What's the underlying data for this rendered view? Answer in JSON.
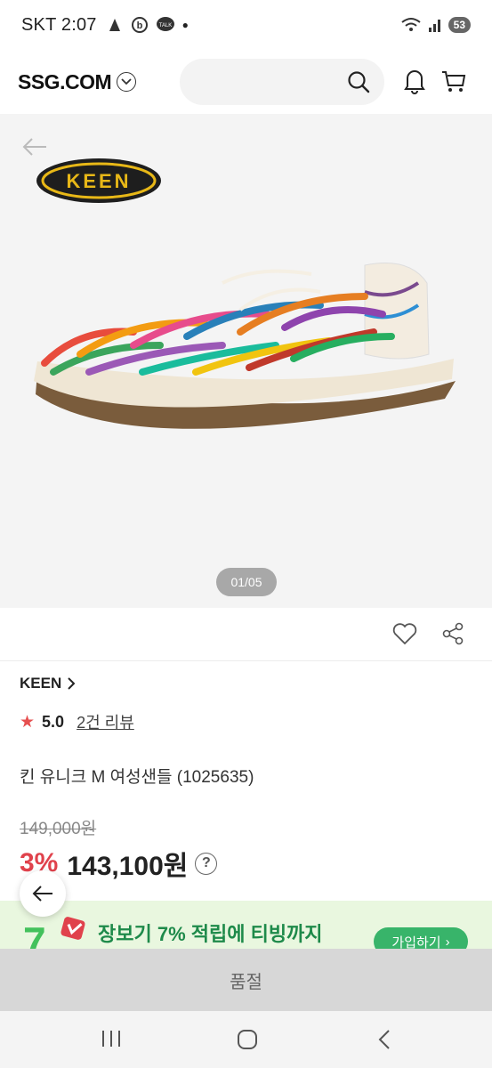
{
  "status_bar": {
    "carrier": "SKT",
    "time": "2:07",
    "battery": "53"
  },
  "header": {
    "logo": "SSG.COM",
    "search_placeholder": ""
  },
  "gallery": {
    "brand_logo_text": "KEEN",
    "pager": "01/05"
  },
  "product": {
    "brand": "KEEN",
    "rating": "5.0",
    "reviews": "2건 리뷰",
    "name": "킨 유니크 M 여성샌들 (1025635)",
    "original_price": "149,000원",
    "discount": "3%",
    "price": "143,100원",
    "help": "?"
  },
  "promo": {
    "text": "장보기 7% 적립에 티빙까지",
    "join": "가입하기",
    "join_arrow": "›"
  },
  "sold_out": "품절",
  "colors": {
    "discount": "#e0424c",
    "promo_text": "#1e8a4a",
    "promo_button": "#38b46a",
    "rating_star": "#e65050"
  }
}
